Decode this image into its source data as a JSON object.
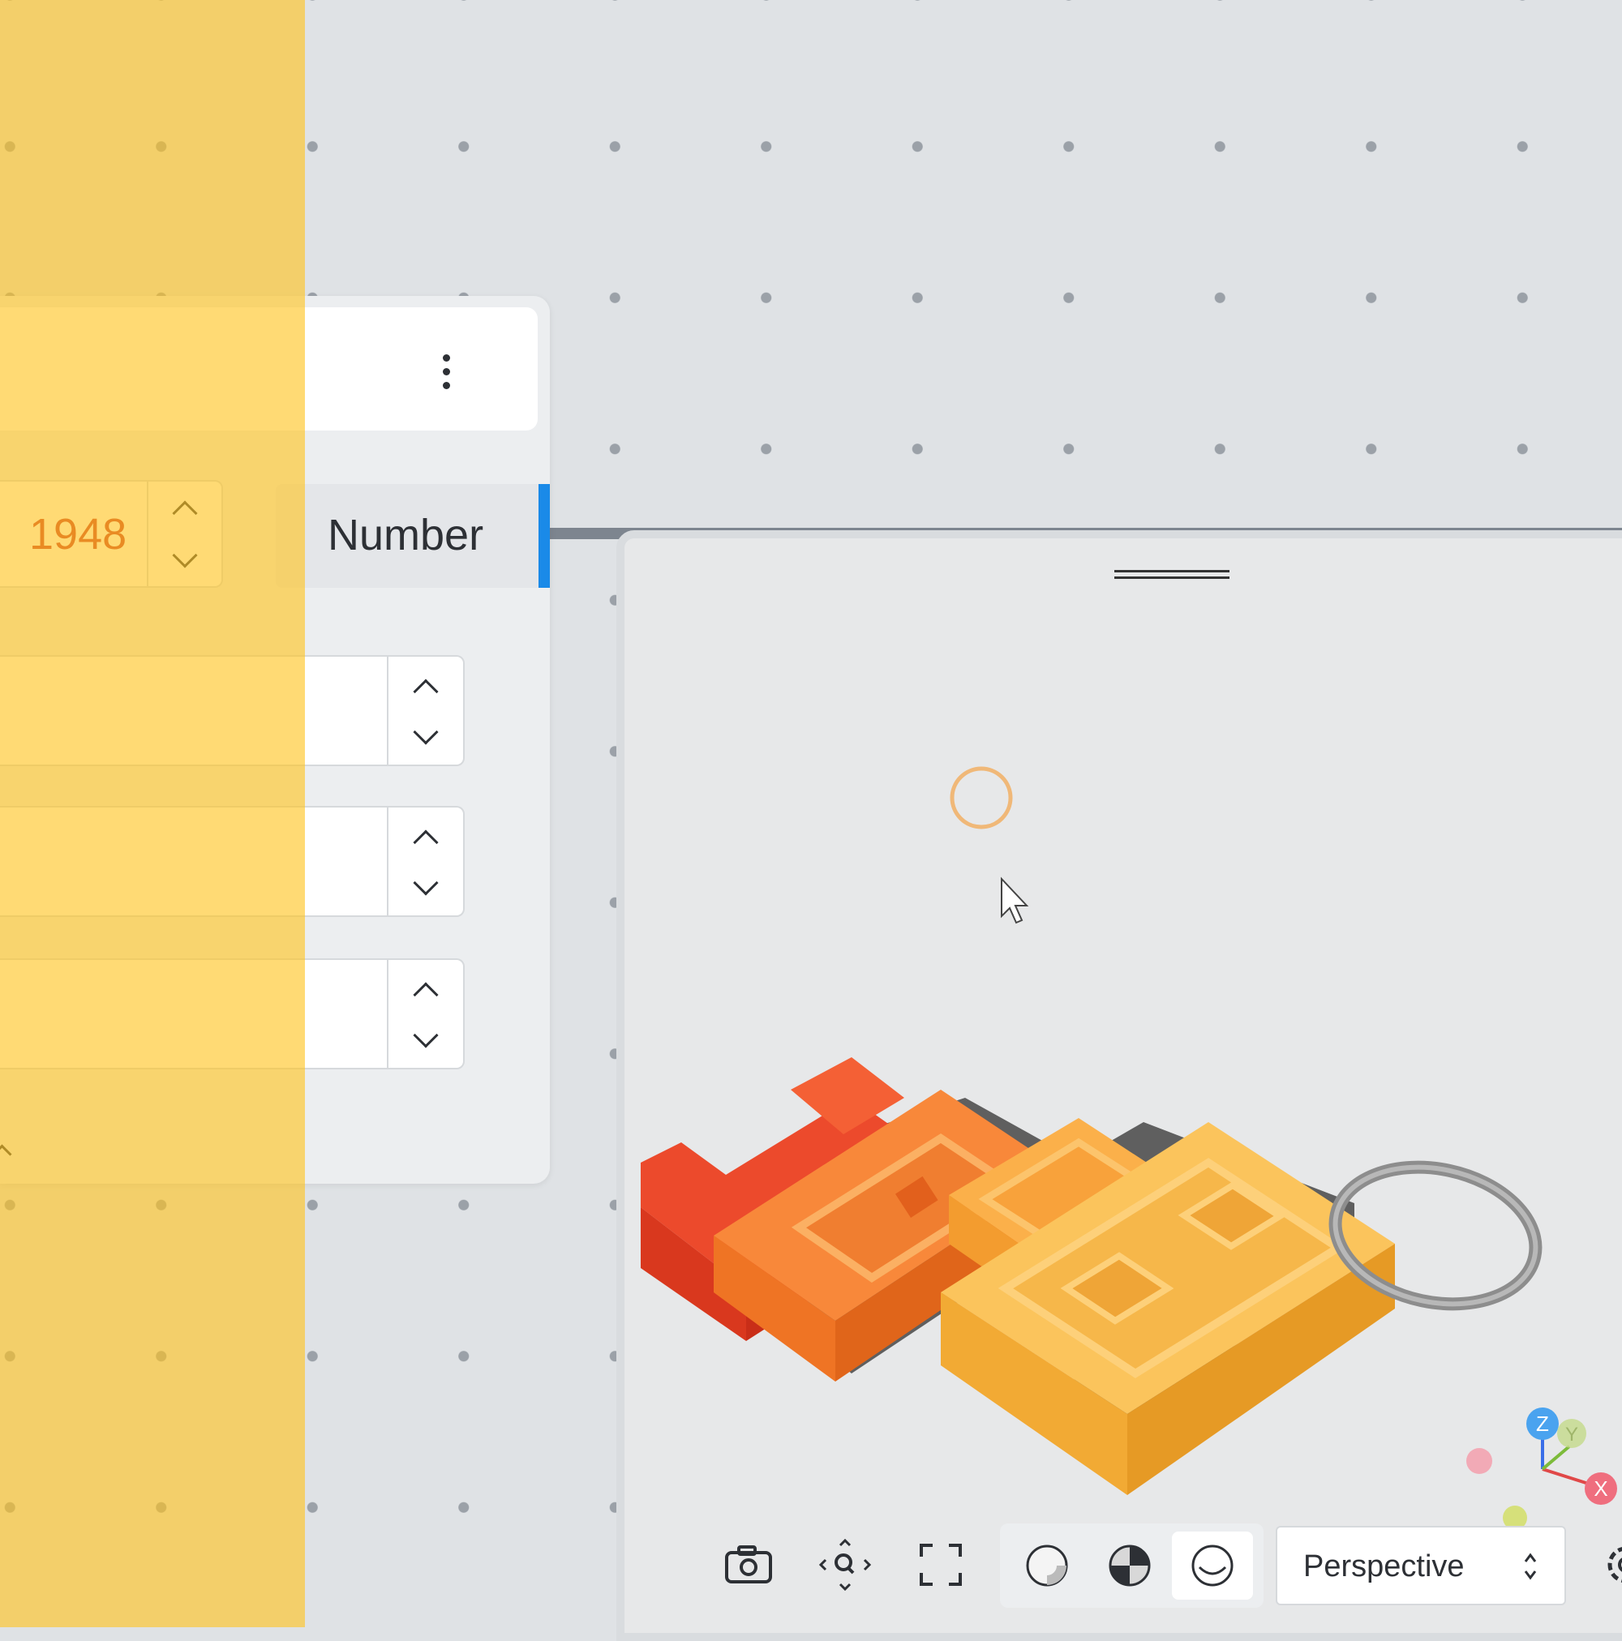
{
  "node": {
    "value": "1948",
    "type_label": "Number",
    "accent_color": "#1a8ae8",
    "value_color": "#c5302a",
    "menu_icon": "kebab-menu-icon"
  },
  "viewer": {
    "projection": "Perspective",
    "toolbar_icons": [
      "camera-icon",
      "zoom-fit-icon",
      "fullscreen-icon",
      "shading-flat-icon",
      "shading-checker-icon",
      "shading-smooth-icon",
      "settings-icon"
    ],
    "axis_labels": {
      "x": "X",
      "y": "Y",
      "z": "Z"
    },
    "model_colors": [
      "#f2512c",
      "#f57e2e",
      "#f9a43a",
      "#f7be55"
    ]
  },
  "highlight_color": "#ffc41e"
}
